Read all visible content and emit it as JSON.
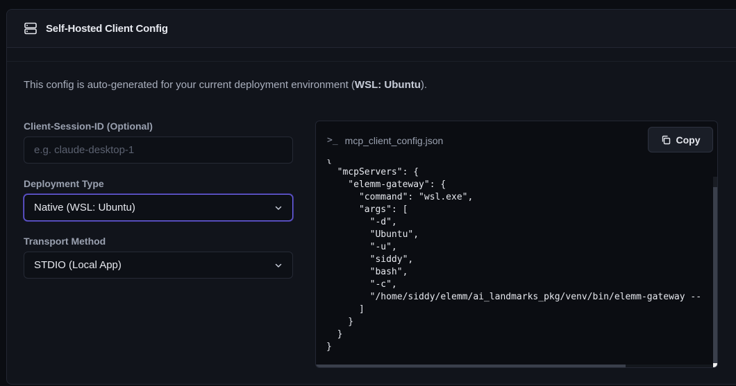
{
  "header": {
    "title": "Self-Hosted Client Config",
    "icon": "server-icon"
  },
  "description": {
    "prefix": "This config is auto-generated for your current deployment environment (",
    "env": "WSL: Ubuntu",
    "suffix": ")."
  },
  "form": {
    "session": {
      "label": "Client-Session-ID (Optional)",
      "placeholder": "e.g. claude-desktop-1",
      "value": ""
    },
    "deployment": {
      "label": "Deployment Type",
      "value": "Native (WSL: Ubuntu)"
    },
    "transport": {
      "label": "Transport Method",
      "value": "STDIO (Local App)"
    }
  },
  "code": {
    "filename": "mcp_client_config.json",
    "copy_label": "Copy",
    "content": "{\n  \"mcpServers\": {\n    \"elemm-gateway\": {\n      \"command\": \"wsl.exe\",\n      \"args\": [\n        \"-d\",\n        \"Ubuntu\",\n        \"-u\",\n        \"siddy\",\n        \"bash\",\n        \"-c\",\n        \"/home/siddy/elemm/ai_landmarks_pkg/venv/bin/elemm-gateway --\n      ]\n    }\n  }\n}"
  },
  "colors": {
    "accent": "#6d63e8",
    "background": "#0b0d12",
    "card": "#11141b"
  }
}
